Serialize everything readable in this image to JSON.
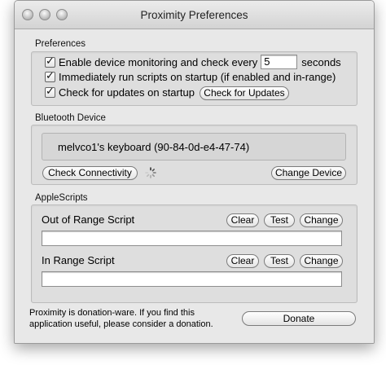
{
  "window": {
    "title": "Proximity Preferences"
  },
  "preferences": {
    "label": "Preferences",
    "monitoring_label": "Enable device monitoring and check every",
    "interval_value": "5",
    "seconds_label": "seconds",
    "run_startup_label": "Immediately run scripts on startup (if enabled and in-range)",
    "check_updates_label": "Check for updates on startup",
    "check_updates_button": "Check for Updates"
  },
  "bluetooth": {
    "label": "Bluetooth Device",
    "device_name": "melvco1's keyboard (90-84-0d-e4-47-74)",
    "check_connectivity_button": "Check Connectivity",
    "change_device_button": "Change Device"
  },
  "applescripts": {
    "label": "AppleScripts",
    "out_of_range_label": "Out of Range Script",
    "in_range_label": "In Range Script",
    "clear_button": "Clear",
    "test_button": "Test",
    "change_button": "Change",
    "out_of_range_value": "",
    "in_range_value": ""
  },
  "footer": {
    "donation_text_line1": "Proximity is donation-ware. If you find this",
    "donation_text_line2": "application useful, please consider a donation.",
    "donate_button": "Donate"
  }
}
